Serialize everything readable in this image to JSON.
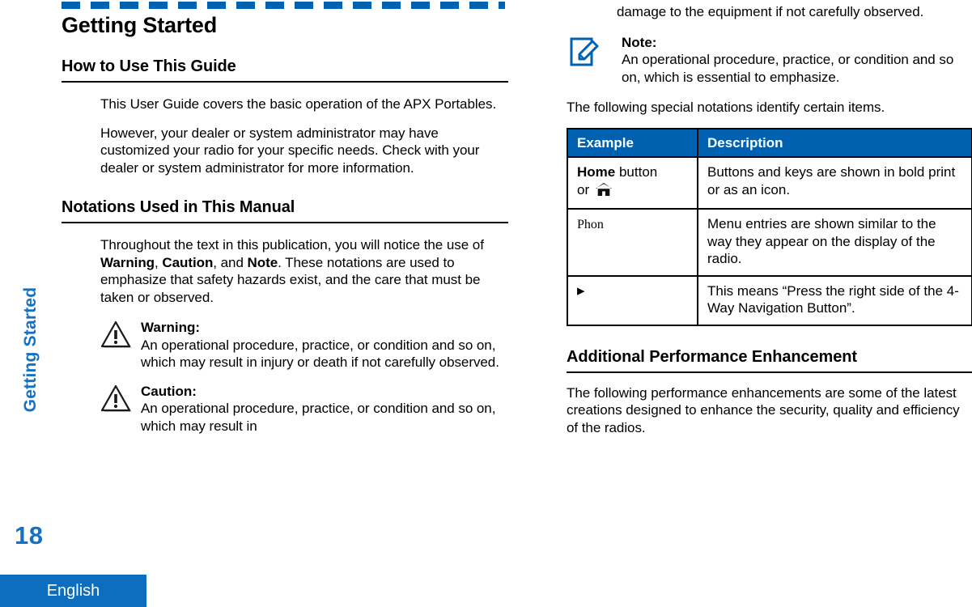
{
  "sidebar": {
    "chapter_tab": "Getting Started",
    "page_number": "18",
    "language_tab": "English",
    "accent_color": "#1472C4",
    "tab_color": "#0D6DBF"
  },
  "header_rule": {
    "color": "#0061B0",
    "style": "dashed"
  },
  "left_column": {
    "chapter_title": "Getting Started",
    "section_1": {
      "heading": "How to Use This Guide",
      "paragraphs": [
        "This User Guide covers the basic operation of the APX Portables.",
        "However, your dealer or system administrator may have customized your radio for your specific needs. Check with your dealer or system administrator for more information."
      ]
    },
    "section_2": {
      "heading": "Notations Used in This Manual",
      "intro_parts": {
        "p1": "Throughout the text in this publication, you will notice the use of ",
        "b1": "Warning",
        "p2": ", ",
        "b2": "Caution",
        "p3": ", and ",
        "b3": "Note",
        "p4": ". These notations are used to emphasize that safety hazards exist, and the care that must be taken or observed."
      },
      "admonitions": [
        {
          "icon": "warning-triangle-icon",
          "title": "Warning:",
          "text": "An operational procedure, practice, or condition and so on, which may result in injury or death if not carefully observed."
        },
        {
          "icon": "caution-triangle-icon",
          "title": "Caution:",
          "text": "An operational procedure, practice, or condition and so on, which may result in"
        }
      ]
    }
  },
  "right_column": {
    "continued_text": "damage to the equipment if not carefully observed.",
    "note_admonition": {
      "icon": "note-pencil-icon",
      "title": "Note:",
      "text": "An operational procedure, practice, or condition and so on, which is essential to emphasize."
    },
    "table_intro": "The following special notations identify certain items.",
    "table": {
      "header_color": "#0061B0",
      "columns": [
        "Example",
        "Description"
      ],
      "rows": [
        {
          "example_prefix_bold": "Home",
          "example_suffix": " button",
          "example_line2": "or ",
          "example_icon": "home-icon",
          "description": "Buttons and keys are shown in bold print or as an icon."
        },
        {
          "example_menu_text": "Phon",
          "description": "Menu entries are shown similar to the way they appear on the display of the radio."
        },
        {
          "example_icon": "right-arrow-icon",
          "description": "This means “Press the right side of the 4-Way Navigation Button”."
        }
      ]
    },
    "section_3": {
      "heading": "Additional Performance Enhancement",
      "paragraph": "The following performance enhancements are some of the latest creations designed to enhance the security, quality and efficiency of the radios."
    }
  }
}
